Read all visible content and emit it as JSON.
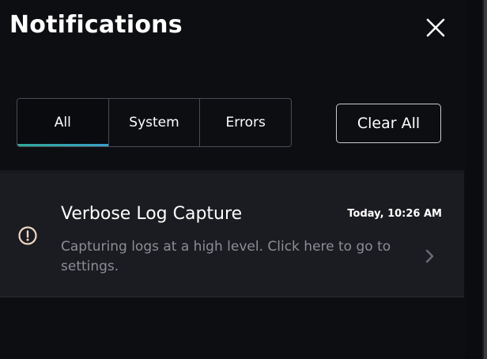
{
  "header": {
    "title": "Notifications",
    "close_icon": "close-icon"
  },
  "tabs": [
    {
      "label": "All",
      "active": true
    },
    {
      "label": "System",
      "active": false
    },
    {
      "label": "Errors",
      "active": false
    }
  ],
  "actions": {
    "clear_all_label": "Clear All"
  },
  "notifications": [
    {
      "icon": "alert-circle-icon",
      "title": "Verbose Log Capture",
      "time": "Today, 10:26 AM",
      "message": "Capturing logs at a high level. Click here to go to settings."
    }
  ],
  "colors": {
    "background": "#0d0e12",
    "card": "#1b1c21",
    "accent": "#2fa89a",
    "icon_warning": "#f1d7c2"
  }
}
